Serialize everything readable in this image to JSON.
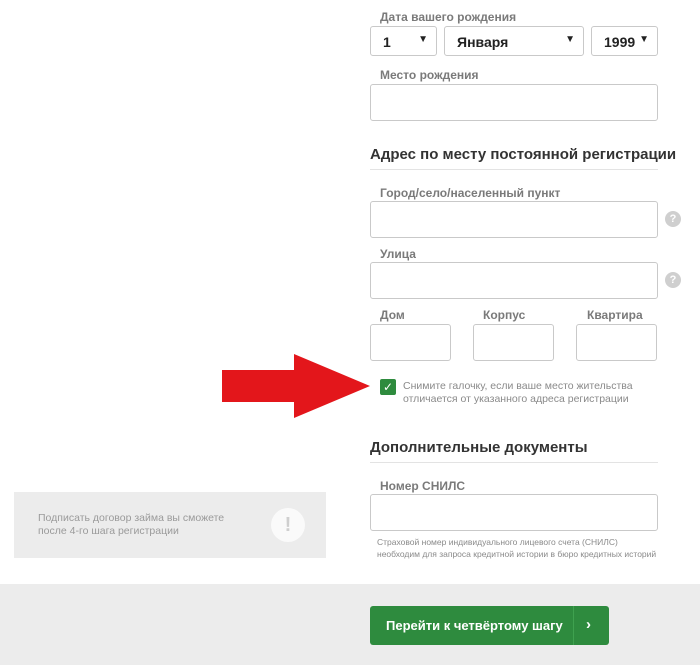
{
  "birth_date": {
    "label": "Дата вашего рождения",
    "day": "1",
    "month": "Января",
    "year": "1999",
    "caret": "▼"
  },
  "birth_place": {
    "label": "Место рождения",
    "value": ""
  },
  "address_section": {
    "title": "Адрес по месту постоянной регистрации",
    "city_label": "Город/село/населенный пункт",
    "street_label": "Улица",
    "house_label": "Дом",
    "building_label": "Корпус",
    "apartment_label": "Квартира",
    "help_glyph": "?"
  },
  "residence_checkbox": {
    "checked": true,
    "check_glyph": "✓",
    "text_line1": "Снимите галочку, если ваше место жительства",
    "text_line2": "отличается от указанного адреса регистрации"
  },
  "documents_section": {
    "title": "Дополнительные документы",
    "snils_label": "Номер СНИЛС",
    "snils_note_line1": "Страховой номер индивидуального лицевого счета (СНИЛС)",
    "snils_note_line2": "необходим для запроса кредитной истории в бюро кредитных историй"
  },
  "info_box": {
    "line1": "Подписать договор займа вы сможете",
    "line2": "после 4-го шага регистрации",
    "icon_glyph": "!"
  },
  "next_button": {
    "label": "Перейти к четвёртому шагу",
    "chevron": "›"
  },
  "annotation_arrow": {
    "color": "#e3161b"
  }
}
